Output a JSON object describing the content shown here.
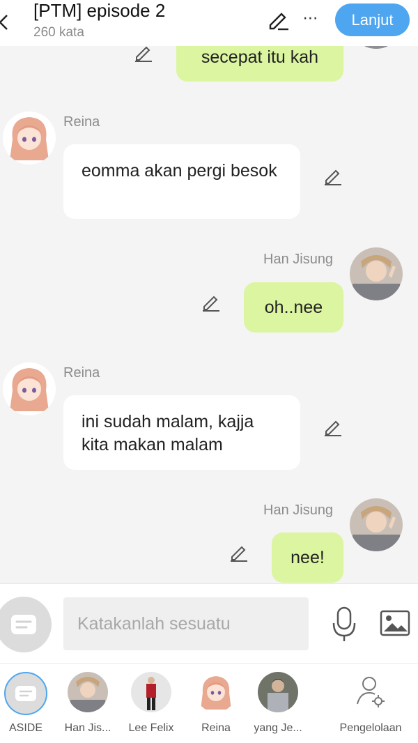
{
  "header": {
    "title": "[PTM] episode 2",
    "word_count": "260 kata",
    "next_label": "Lanjut"
  },
  "messages": [
    {
      "side": "right",
      "text": "secepat itu kah"
    },
    {
      "side": "left",
      "speaker": "Reina",
      "text": "eomma akan pergi besok"
    },
    {
      "side": "right",
      "speaker": "Han Jisung",
      "text": "oh..nee"
    },
    {
      "side": "left",
      "speaker": "Reina",
      "text": "ini sudah malam, kajja kita makan malam"
    },
    {
      "side": "right",
      "speaker": "Han Jisung",
      "text": "nee!"
    }
  ],
  "input": {
    "placeholder": "Katakanlah sesuatu"
  },
  "characters": [
    {
      "label": "ASIDE"
    },
    {
      "label": "Han Jis..."
    },
    {
      "label": "Lee Felix"
    },
    {
      "label": "Reina"
    },
    {
      "label": "yang Je..."
    },
    {
      "label": "Pengelolaan"
    }
  ],
  "colors": {
    "accent": "#4ea6f0",
    "right_bubble": "#dcf5a0",
    "left_bubble": "#ffffff",
    "background": "#f4f4f4"
  }
}
